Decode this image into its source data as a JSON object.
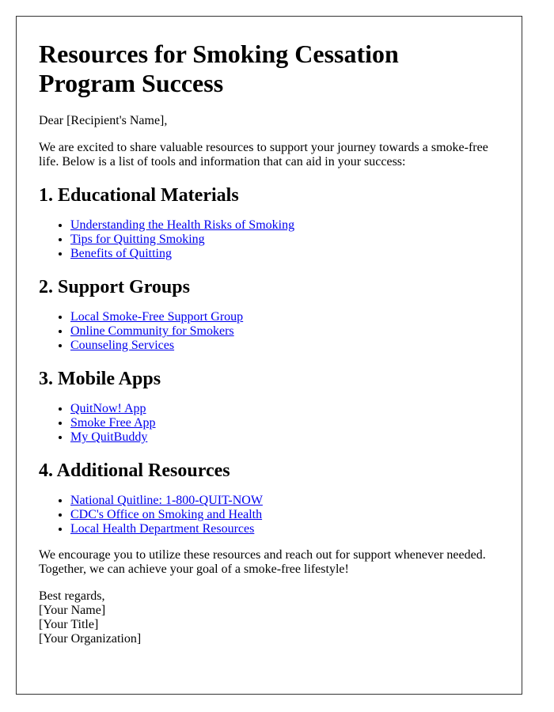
{
  "title": "Resources for Smoking Cessation Program Success",
  "greeting": "Dear [Recipient's Name],",
  "intro": "We are excited to share valuable resources to support your journey towards a smoke-free life. Below is a list of tools and information that can aid in your success:",
  "sections": [
    {
      "heading": "1. Educational Materials",
      "links": [
        "Understanding the Health Risks of Smoking",
        "Tips for Quitting Smoking",
        "Benefits of Quitting"
      ]
    },
    {
      "heading": "2. Support Groups",
      "links": [
        "Local Smoke-Free Support Group",
        "Online Community for Smokers",
        "Counseling Services"
      ]
    },
    {
      "heading": "3. Mobile Apps",
      "links": [
        "QuitNow! App",
        "Smoke Free App",
        "My QuitBuddy"
      ]
    },
    {
      "heading": "4. Additional Resources",
      "links": [
        "National Quitline: 1-800-QUIT-NOW",
        "CDC's Office on Smoking and Health",
        "Local Health Department Resources"
      ]
    }
  ],
  "closing": "We encourage you to utilize these resources and reach out for support whenever needed. Together, we can achieve your goal of a smoke-free lifestyle!",
  "signoff": {
    "regards": "Best regards,",
    "name": "[Your Name]",
    "title": "[Your Title]",
    "organization": "[Your Organization]"
  },
  "colors": {
    "link": "#0000ee",
    "border": "#333333",
    "text": "#000000"
  }
}
